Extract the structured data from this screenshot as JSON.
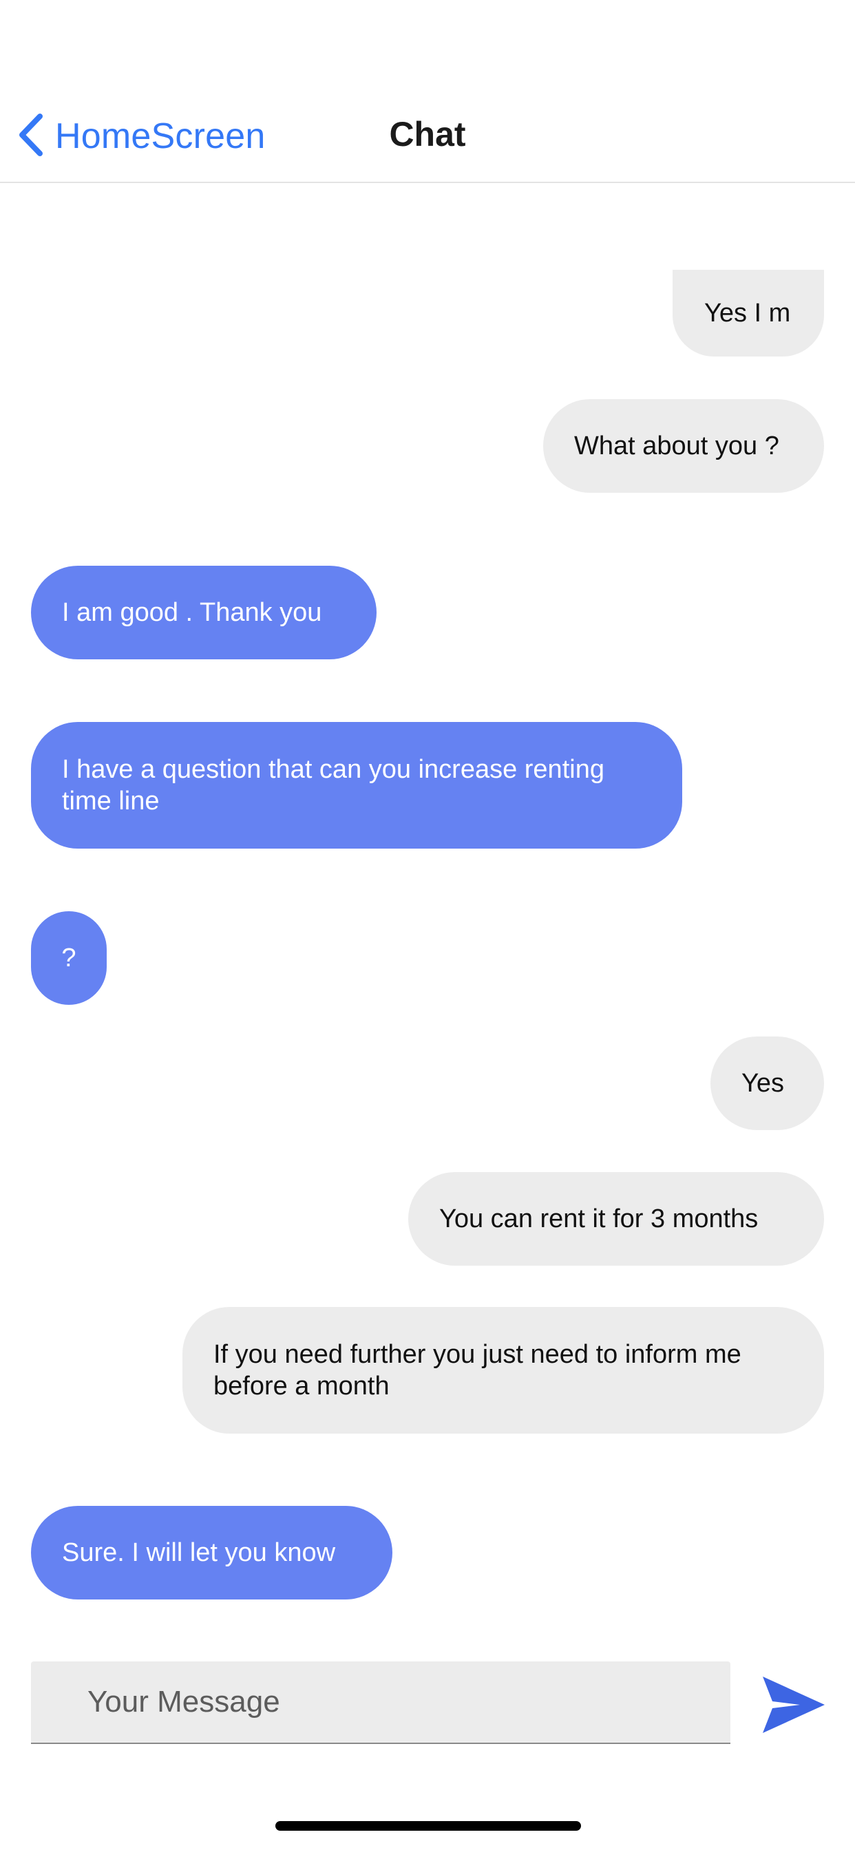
{
  "nav": {
    "back_label": "HomeScreen",
    "title": "Chat"
  },
  "messages": [
    {
      "text": "Yes I m",
      "from": "sent"
    },
    {
      "text": "What about you ?",
      "from": "sent"
    },
    {
      "text": "I am good . Thank you",
      "from": "received"
    },
    {
      "text": "I have a question that can you increase renting time line",
      "from": "received"
    },
    {
      "text": "?",
      "from": "received"
    },
    {
      "text": "Yes",
      "from": "sent"
    },
    {
      "text": "You can rent it for 3 months",
      "from": "sent"
    },
    {
      "text": "If you need further you just need to inform me before a month",
      "from": "sent"
    },
    {
      "text": "Sure. I will let you know",
      "from": "received"
    }
  ],
  "composer": {
    "placeholder": "Your Message",
    "send_icon": "send-arrow-icon"
  },
  "colors": {
    "accent": "#3478f6",
    "received_bubble": "#6582f2",
    "sent_bubble": "#ececec",
    "send_icon": "#3d65e3"
  }
}
